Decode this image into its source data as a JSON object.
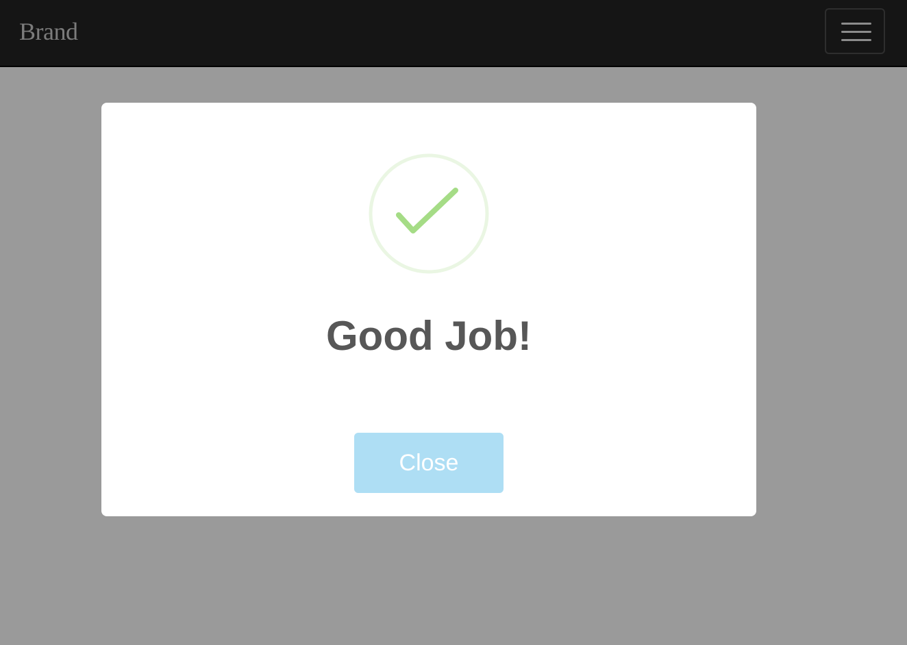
{
  "navbar": {
    "brand": "Brand",
    "menu_icon": "hamburger-menu-icon",
    "background_color": "#151515"
  },
  "modal": {
    "icon": "check-circle-icon",
    "icon_color": "#a5dc86",
    "title": "Good Job!",
    "close_label": "Close",
    "close_button_color": "#aedef4"
  },
  "overlay_color": "#9a9a9a"
}
